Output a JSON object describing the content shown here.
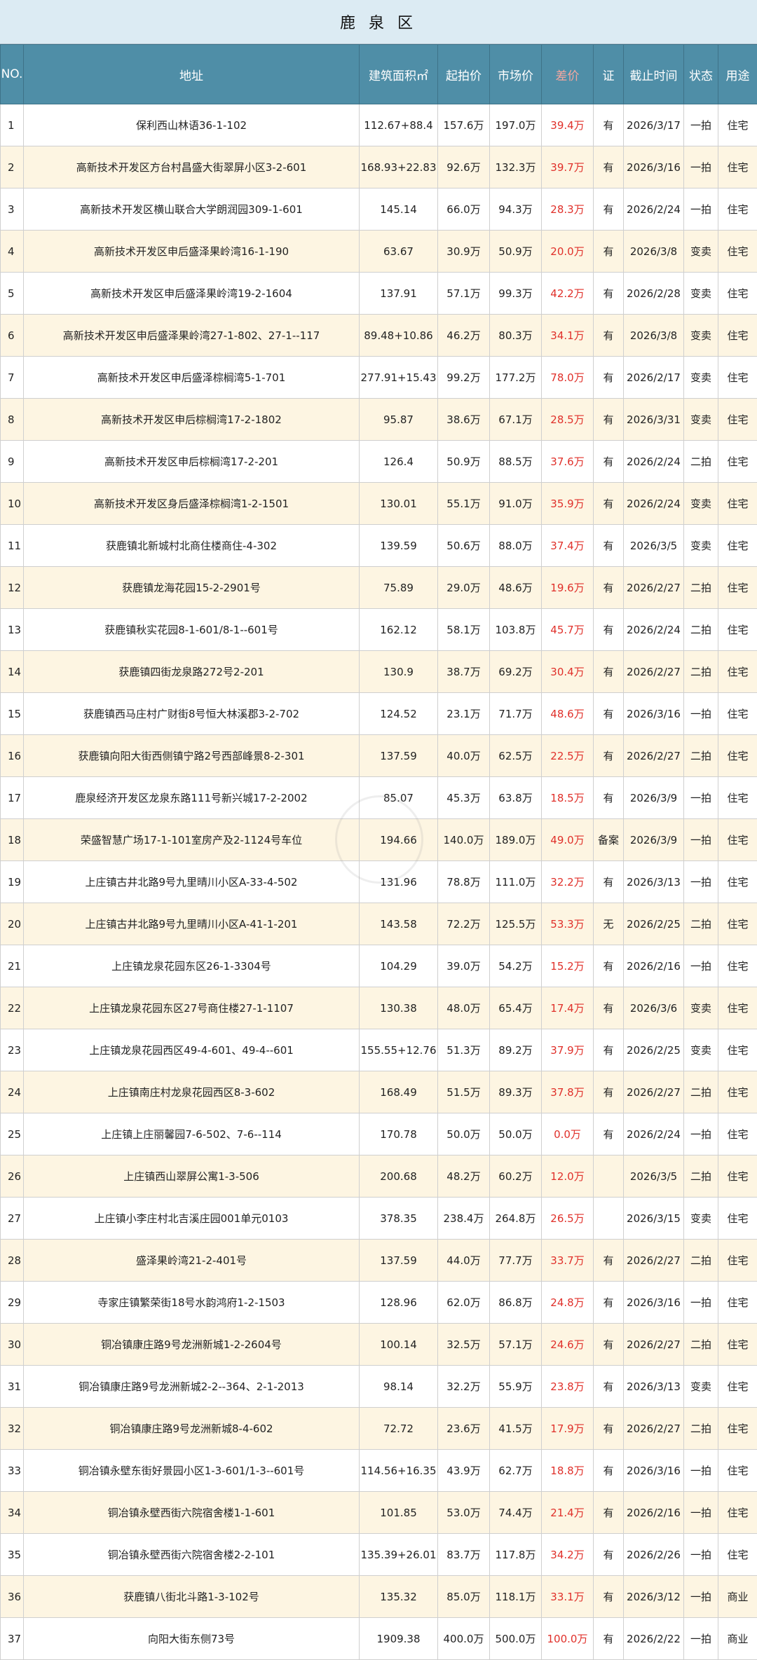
{
  "title": "鹿 泉 区",
  "headers": {
    "no": "NO.",
    "address": "地址",
    "area": "建筑面积㎡",
    "start_price": "起拍价",
    "market_price": "市场价",
    "diff": "差价",
    "cert": "证",
    "deadline": "截止时间",
    "status": "状态",
    "usage": "用途"
  },
  "rows": [
    {
      "no": "1",
      "address": "保利西山林语36-1-102",
      "area": "112.67+88.4",
      "start": "157.6万",
      "market": "197.0万",
      "diff": "39.4万",
      "cert": "有",
      "deadline": "2026/3/17",
      "status": "一拍",
      "usage": "住宅"
    },
    {
      "no": "2",
      "address": "高新技术开发区方台村昌盛大街翠屏小区3-2-601",
      "area": "168.93+22.83",
      "start": "92.6万",
      "market": "132.3万",
      "diff": "39.7万",
      "cert": "有",
      "deadline": "2026/3/16",
      "status": "一拍",
      "usage": "住宅"
    },
    {
      "no": "3",
      "address": "高新技术开发区横山联合大学朗润园309-1-601",
      "area": "145.14",
      "start": "66.0万",
      "market": "94.3万",
      "diff": "28.3万",
      "cert": "有",
      "deadline": "2026/2/24",
      "status": "一拍",
      "usage": "住宅"
    },
    {
      "no": "4",
      "address": "高新技术开发区申后盛泽果岭湾16-1-190",
      "area": "63.67",
      "start": "30.9万",
      "market": "50.9万",
      "diff": "20.0万",
      "cert": "有",
      "deadline": "2026/3/8",
      "status": "变卖",
      "usage": "住宅"
    },
    {
      "no": "5",
      "address": "高新技术开发区申后盛泽果岭湾19-2-1604",
      "area": "137.91",
      "start": "57.1万",
      "market": "99.3万",
      "diff": "42.2万",
      "cert": "有",
      "deadline": "2026/2/28",
      "status": "变卖",
      "usage": "住宅"
    },
    {
      "no": "6",
      "address": "高新技术开发区申后盛泽果岭湾27-1-802、27-1--117",
      "area": "89.48+10.86",
      "start": "46.2万",
      "market": "80.3万",
      "diff": "34.1万",
      "cert": "有",
      "deadline": "2026/3/8",
      "status": "变卖",
      "usage": "住宅"
    },
    {
      "no": "7",
      "address": "高新技术开发区申后盛泽棕榈湾5-1-701",
      "area": "277.91+15.43",
      "start": "99.2万",
      "market": "177.2万",
      "diff": "78.0万",
      "cert": "有",
      "deadline": "2026/2/17",
      "status": "变卖",
      "usage": "住宅"
    },
    {
      "no": "8",
      "address": "高新技术开发区申后棕榈湾17-2-1802",
      "area": "95.87",
      "start": "38.6万",
      "market": "67.1万",
      "diff": "28.5万",
      "cert": "有",
      "deadline": "2026/3/31",
      "status": "变卖",
      "usage": "住宅"
    },
    {
      "no": "9",
      "address": "高新技术开发区申后棕榈湾17-2-201",
      "area": "126.4",
      "start": "50.9万",
      "market": "88.5万",
      "diff": "37.6万",
      "cert": "有",
      "deadline": "2026/2/24",
      "status": "二拍",
      "usage": "住宅"
    },
    {
      "no": "10",
      "address": "高新技术开发区身后盛泽棕榈湾1-2-1501",
      "area": "130.01",
      "start": "55.1万",
      "market": "91.0万",
      "diff": "35.9万",
      "cert": "有",
      "deadline": "2026/2/24",
      "status": "变卖",
      "usage": "住宅"
    },
    {
      "no": "11",
      "address": "获鹿镇北新城村北商住楼商住-4-302",
      "area": "139.59",
      "start": "50.6万",
      "market": "88.0万",
      "diff": "37.4万",
      "cert": "有",
      "deadline": "2026/3/5",
      "status": "变卖",
      "usage": "住宅"
    },
    {
      "no": "12",
      "address": "获鹿镇龙海花园15-2-2901号",
      "area": "75.89",
      "start": "29.0万",
      "market": "48.6万",
      "diff": "19.6万",
      "cert": "有",
      "deadline": "2026/2/27",
      "status": "二拍",
      "usage": "住宅"
    },
    {
      "no": "13",
      "address": "获鹿镇秋实花园8-1-601/8-1--601号",
      "area": "162.12",
      "start": "58.1万",
      "market": "103.8万",
      "diff": "45.7万",
      "cert": "有",
      "deadline": "2026/2/24",
      "status": "二拍",
      "usage": "住宅"
    },
    {
      "no": "14",
      "address": "获鹿镇四街龙泉路272号2-201",
      "area": "130.9",
      "start": "38.7万",
      "market": "69.2万",
      "diff": "30.4万",
      "cert": "有",
      "deadline": "2026/2/27",
      "status": "二拍",
      "usage": "住宅"
    },
    {
      "no": "15",
      "address": "获鹿镇西马庄村广财街8号恒大林溪郡3-2-702",
      "area": "124.52",
      "start": "23.1万",
      "market": "71.7万",
      "diff": "48.6万",
      "cert": "有",
      "deadline": "2026/3/16",
      "status": "一拍",
      "usage": "住宅"
    },
    {
      "no": "16",
      "address": "获鹿镇向阳大街西侧镇宁路2号西部峰景8-2-301",
      "area": "137.59",
      "start": "40.0万",
      "market": "62.5万",
      "diff": "22.5万",
      "cert": "有",
      "deadline": "2026/2/27",
      "status": "二拍",
      "usage": "住宅"
    },
    {
      "no": "17",
      "address": "鹿泉经济开发区龙泉东路111号新兴城17-2-2002",
      "area": "85.07",
      "start": "45.3万",
      "market": "63.8万",
      "diff": "18.5万",
      "cert": "有",
      "deadline": "2026/3/9",
      "status": "一拍",
      "usage": "住宅"
    },
    {
      "no": "18",
      "address": "荣盛智慧广场17-1-101室房产及2-1124号车位",
      "area": "194.66",
      "start": "140.0万",
      "market": "189.0万",
      "diff": "49.0万",
      "cert": "备案",
      "deadline": "2026/3/9",
      "status": "一拍",
      "usage": "住宅"
    },
    {
      "no": "19",
      "address": "上庄镇古井北路9号九里晴川小区A-33-4-502",
      "area": "131.96",
      "start": "78.8万",
      "market": "111.0万",
      "diff": "32.2万",
      "cert": "有",
      "deadline": "2026/3/13",
      "status": "一拍",
      "usage": "住宅"
    },
    {
      "no": "20",
      "address": "上庄镇古井北路9号九里晴川小区A-41-1-201",
      "area": "143.58",
      "start": "72.2万",
      "market": "125.5万",
      "diff": "53.3万",
      "cert": "无",
      "deadline": "2026/2/25",
      "status": "二拍",
      "usage": "住宅"
    },
    {
      "no": "21",
      "address": "上庄镇龙泉花园东区26-1-3304号",
      "area": "104.29",
      "start": "39.0万",
      "market": "54.2万",
      "diff": "15.2万",
      "cert": "有",
      "deadline": "2026/2/16",
      "status": "一拍",
      "usage": "住宅"
    },
    {
      "no": "22",
      "address": "上庄镇龙泉花园东区27号商住楼27-1-1107",
      "area": "130.38",
      "start": "48.0万",
      "market": "65.4万",
      "diff": "17.4万",
      "cert": "有",
      "deadline": "2026/3/6",
      "status": "变卖",
      "usage": "住宅"
    },
    {
      "no": "23",
      "address": "上庄镇龙泉花园西区49-4-601、49-4--601",
      "area": "155.55+12.76",
      "start": "51.3万",
      "market": "89.2万",
      "diff": "37.9万",
      "cert": "有",
      "deadline": "2026/2/25",
      "status": "变卖",
      "usage": "住宅"
    },
    {
      "no": "24",
      "address": "上庄镇南庄村龙泉花园西区8-3-602",
      "area": "168.49",
      "start": "51.5万",
      "market": "89.3万",
      "diff": "37.8万",
      "cert": "有",
      "deadline": "2026/2/27",
      "status": "二拍",
      "usage": "住宅"
    },
    {
      "no": "25",
      "address": "上庄镇上庄丽馨园7-6-502、7-6--114",
      "area": "170.78",
      "start": "50.0万",
      "market": "50.0万",
      "diff": "0.0万",
      "cert": "有",
      "deadline": "2026/2/24",
      "status": "一拍",
      "usage": "住宅"
    },
    {
      "no": "26",
      "address": "上庄镇西山翠屏公寓1-3-506",
      "area": "200.68",
      "start": "48.2万",
      "market": "60.2万",
      "diff": "12.0万",
      "cert": "",
      "deadline": "2026/3/5",
      "status": "二拍",
      "usage": "住宅"
    },
    {
      "no": "27",
      "address": "上庄镇小李庄村北吉溪庄园001单元0103",
      "area": "378.35",
      "start": "238.4万",
      "market": "264.8万",
      "diff": "26.5万",
      "cert": "",
      "deadline": "2026/3/15",
      "status": "变卖",
      "usage": "住宅"
    },
    {
      "no": "28",
      "address": "盛泽果岭湾21-2-401号",
      "area": "137.59",
      "start": "44.0万",
      "market": "77.7万",
      "diff": "33.7万",
      "cert": "有",
      "deadline": "2026/2/27",
      "status": "二拍",
      "usage": "住宅"
    },
    {
      "no": "29",
      "address": "寺家庄镇繁荣街18号水韵鸿府1-2-1503",
      "area": "128.96",
      "start": "62.0万",
      "market": "86.8万",
      "diff": "24.8万",
      "cert": "有",
      "deadline": "2026/3/16",
      "status": "一拍",
      "usage": "住宅"
    },
    {
      "no": "30",
      "address": "铜冶镇康庄路9号龙洲新城1-2-2604号",
      "area": "100.14",
      "start": "32.5万",
      "market": "57.1万",
      "diff": "24.6万",
      "cert": "有",
      "deadline": "2026/2/27",
      "status": "二拍",
      "usage": "住宅"
    },
    {
      "no": "31",
      "address": "铜冶镇康庄路9号龙洲新城2-2--364、2-1-2013",
      "area": "98.14",
      "start": "32.2万",
      "market": "55.9万",
      "diff": "23.8万",
      "cert": "有",
      "deadline": "2026/3/13",
      "status": "变卖",
      "usage": "住宅"
    },
    {
      "no": "32",
      "address": "铜冶镇康庄路9号龙洲新城8-4-602",
      "area": "72.72",
      "start": "23.6万",
      "market": "41.5万",
      "diff": "17.9万",
      "cert": "有",
      "deadline": "2026/2/27",
      "status": "二拍",
      "usage": "住宅"
    },
    {
      "no": "33",
      "address": "铜冶镇永壁东街好景园小区1-3-601/1-3--601号",
      "area": "114.56+16.35",
      "start": "43.9万",
      "market": "62.7万",
      "diff": "18.8万",
      "cert": "有",
      "deadline": "2026/3/16",
      "status": "一拍",
      "usage": "住宅"
    },
    {
      "no": "34",
      "address": "铜冶镇永壁西街六院宿舍楼1-1-601",
      "area": "101.85",
      "start": "53.0万",
      "market": "74.4万",
      "diff": "21.4万",
      "cert": "有",
      "deadline": "2026/2/16",
      "status": "一拍",
      "usage": "住宅"
    },
    {
      "no": "35",
      "address": "铜冶镇永壁西街六院宿舍楼2-2-101",
      "area": "135.39+26.01",
      "start": "83.7万",
      "market": "117.8万",
      "diff": "34.2万",
      "cert": "有",
      "deadline": "2026/2/26",
      "status": "一拍",
      "usage": "住宅"
    },
    {
      "no": "36",
      "address": "获鹿镇八街北斗路1-3-102号",
      "area": "135.32",
      "start": "85.0万",
      "market": "118.1万",
      "diff": "33.1万",
      "cert": "有",
      "deadline": "2026/3/12",
      "status": "一拍",
      "usage": "商业"
    },
    {
      "no": "37",
      "address": "向阳大街东侧73号",
      "area": "1909.38",
      "start": "400.0万",
      "market": "500.0万",
      "diff": "100.0万",
      "cert": "有",
      "deadline": "2026/2/22",
      "status": "一拍",
      "usage": "商业"
    }
  ]
}
